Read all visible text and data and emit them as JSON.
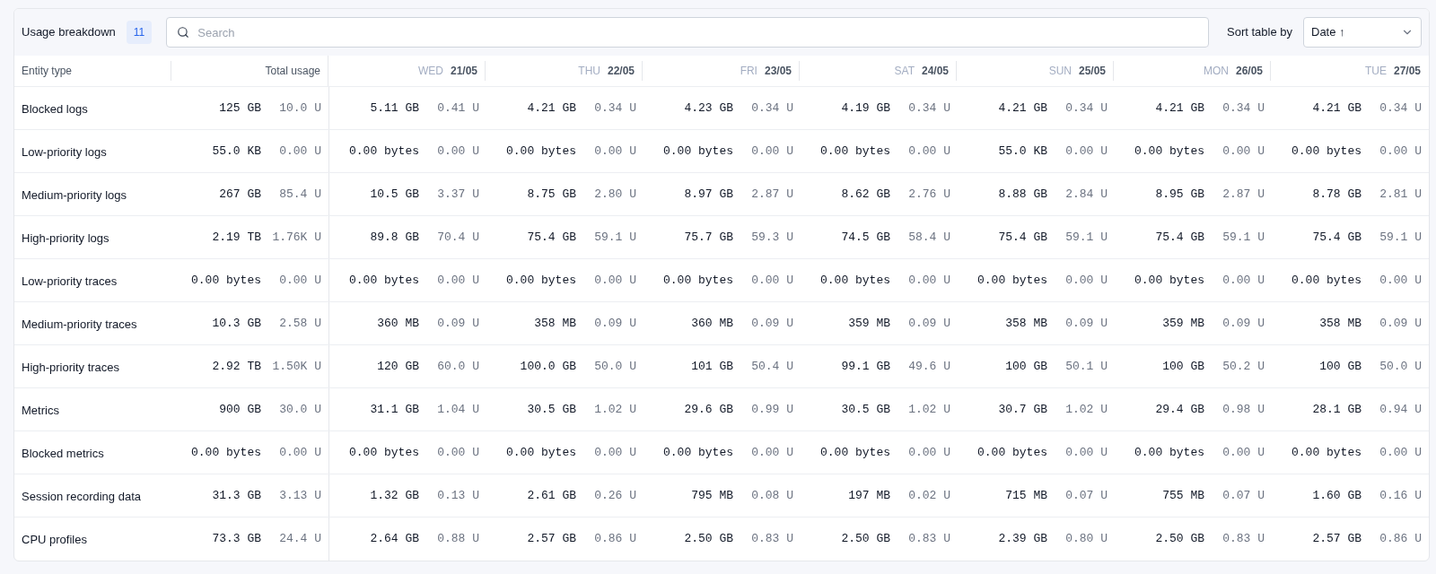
{
  "header": {
    "title": "Usage breakdown",
    "count": "11",
    "search": {
      "placeholder": "Search"
    },
    "sort_label": "Sort table by",
    "sort_value": "Date ↑"
  },
  "table": {
    "columns": {
      "entity": "Entity type",
      "total": "Total usage",
      "days": [
        {
          "weekday": "WED",
          "date": "21/05"
        },
        {
          "weekday": "THU",
          "date": "22/05"
        },
        {
          "weekday": "FRI",
          "date": "23/05"
        },
        {
          "weekday": "SAT",
          "date": "24/05"
        },
        {
          "weekday": "SUN",
          "date": "25/05"
        },
        {
          "weekday": "MON",
          "date": "26/05"
        },
        {
          "weekday": "TUE",
          "date": "27/05"
        }
      ]
    },
    "rows": [
      {
        "name": "Blocked logs",
        "total": [
          "125 GB",
          "10.0 U"
        ],
        "days": [
          [
            "5.11 GB",
            "0.41 U"
          ],
          [
            "4.21 GB",
            "0.34 U"
          ],
          [
            "4.23 GB",
            "0.34 U"
          ],
          [
            "4.19 GB",
            "0.34 U"
          ],
          [
            "4.21 GB",
            "0.34 U"
          ],
          [
            "4.21 GB",
            "0.34 U"
          ],
          [
            "4.21 GB",
            "0.34 U"
          ]
        ]
      },
      {
        "name": "Low-priority logs",
        "total": [
          "55.0 KB",
          "0.00 U"
        ],
        "days": [
          [
            "0.00 bytes",
            "0.00 U"
          ],
          [
            "0.00 bytes",
            "0.00 U"
          ],
          [
            "0.00 bytes",
            "0.00 U"
          ],
          [
            "0.00 bytes",
            "0.00 U"
          ],
          [
            "55.0 KB",
            "0.00 U"
          ],
          [
            "0.00 bytes",
            "0.00 U"
          ],
          [
            "0.00 bytes",
            "0.00 U"
          ]
        ]
      },
      {
        "name": "Medium-priority logs",
        "total": [
          "267 GB",
          "85.4 U"
        ],
        "days": [
          [
            "10.5 GB",
            "3.37 U"
          ],
          [
            "8.75 GB",
            "2.80 U"
          ],
          [
            "8.97 GB",
            "2.87 U"
          ],
          [
            "8.62 GB",
            "2.76 U"
          ],
          [
            "8.88 GB",
            "2.84 U"
          ],
          [
            "8.95 GB",
            "2.87 U"
          ],
          [
            "8.78 GB",
            "2.81 U"
          ]
        ]
      },
      {
        "name": "High-priority logs",
        "total": [
          "2.19 TB",
          "1.76K U"
        ],
        "days": [
          [
            "89.8 GB",
            "70.4 U"
          ],
          [
            "75.4 GB",
            "59.1 U"
          ],
          [
            "75.7 GB",
            "59.3 U"
          ],
          [
            "74.5 GB",
            "58.4 U"
          ],
          [
            "75.4 GB",
            "59.1 U"
          ],
          [
            "75.4 GB",
            "59.1 U"
          ],
          [
            "75.4 GB",
            "59.1 U"
          ]
        ]
      },
      {
        "name": "Low-priority traces",
        "total": [
          "0.00 bytes",
          "0.00 U"
        ],
        "days": [
          [
            "0.00 bytes",
            "0.00 U"
          ],
          [
            "0.00 bytes",
            "0.00 U"
          ],
          [
            "0.00 bytes",
            "0.00 U"
          ],
          [
            "0.00 bytes",
            "0.00 U"
          ],
          [
            "0.00 bytes",
            "0.00 U"
          ],
          [
            "0.00 bytes",
            "0.00 U"
          ],
          [
            "0.00 bytes",
            "0.00 U"
          ]
        ]
      },
      {
        "name": "Medium-priority traces",
        "total": [
          "10.3 GB",
          "2.58 U"
        ],
        "days": [
          [
            "360 MB",
            "0.09 U"
          ],
          [
            "358 MB",
            "0.09 U"
          ],
          [
            "360 MB",
            "0.09 U"
          ],
          [
            "359 MB",
            "0.09 U"
          ],
          [
            "358 MB",
            "0.09 U"
          ],
          [
            "359 MB",
            "0.09 U"
          ],
          [
            "358 MB",
            "0.09 U"
          ]
        ]
      },
      {
        "name": "High-priority traces",
        "total": [
          "2.92 TB",
          "1.50K U"
        ],
        "days": [
          [
            "120 GB",
            "60.0 U"
          ],
          [
            "100.0 GB",
            "50.0 U"
          ],
          [
            "101 GB",
            "50.4 U"
          ],
          [
            "99.1 GB",
            "49.6 U"
          ],
          [
            "100 GB",
            "50.1 U"
          ],
          [
            "100 GB",
            "50.2 U"
          ],
          [
            "100 GB",
            "50.0 U"
          ]
        ]
      },
      {
        "name": "Metrics",
        "total": [
          "900 GB",
          "30.0 U"
        ],
        "days": [
          [
            "31.1 GB",
            "1.04 U"
          ],
          [
            "30.5 GB",
            "1.02 U"
          ],
          [
            "29.6 GB",
            "0.99 U"
          ],
          [
            "30.5 GB",
            "1.02 U"
          ],
          [
            "30.7 GB",
            "1.02 U"
          ],
          [
            "29.4 GB",
            "0.98 U"
          ],
          [
            "28.1 GB",
            "0.94 U"
          ]
        ]
      },
      {
        "name": "Blocked metrics",
        "total": [
          "0.00 bytes",
          "0.00 U"
        ],
        "days": [
          [
            "0.00 bytes",
            "0.00 U"
          ],
          [
            "0.00 bytes",
            "0.00 U"
          ],
          [
            "0.00 bytes",
            "0.00 U"
          ],
          [
            "0.00 bytes",
            "0.00 U"
          ],
          [
            "0.00 bytes",
            "0.00 U"
          ],
          [
            "0.00 bytes",
            "0.00 U"
          ],
          [
            "0.00 bytes",
            "0.00 U"
          ]
        ]
      },
      {
        "name": "Session recording data",
        "total": [
          "31.3 GB",
          "3.13 U"
        ],
        "days": [
          [
            "1.32 GB",
            "0.13 U"
          ],
          [
            "2.61 GB",
            "0.26 U"
          ],
          [
            "795 MB",
            "0.08 U"
          ],
          [
            "197 MB",
            "0.02 U"
          ],
          [
            "715 MB",
            "0.07 U"
          ],
          [
            "755 MB",
            "0.07 U"
          ],
          [
            "1.60 GB",
            "0.16 U"
          ]
        ]
      },
      {
        "name": "CPU profiles",
        "total": [
          "73.3 GB",
          "24.4 U"
        ],
        "days": [
          [
            "2.64 GB",
            "0.88 U"
          ],
          [
            "2.57 GB",
            "0.86 U"
          ],
          [
            "2.50 GB",
            "0.83 U"
          ],
          [
            "2.50 GB",
            "0.83 U"
          ],
          [
            "2.39 GB",
            "0.80 U"
          ],
          [
            "2.50 GB",
            "0.83 U"
          ],
          [
            "2.57 GB",
            "0.86 U"
          ]
        ]
      }
    ]
  }
}
